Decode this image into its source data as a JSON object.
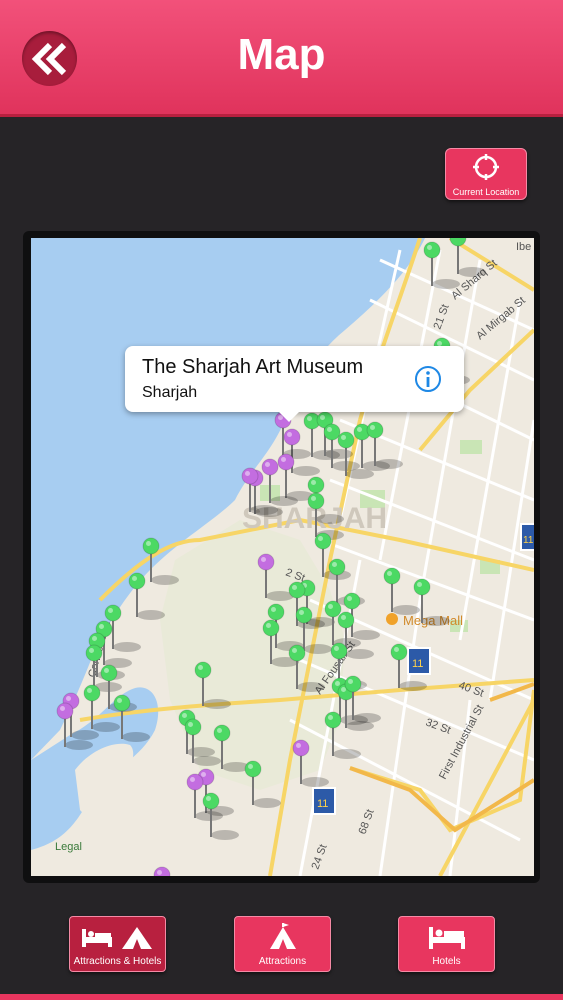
{
  "header": {
    "title": "Map",
    "back_icon": "double-chevron-left-icon"
  },
  "current_location": {
    "label": "Current Location",
    "icon": "crosshair-icon"
  },
  "map": {
    "labels": {
      "city": "SHARJAH",
      "mega_mall": "Mega Mall",
      "al_sharq_st": "Al Sharq St",
      "al_mirgab_st": "Al Mirgab St",
      "st21": "21 St",
      "st2": "2 St",
      "st40": "40 St",
      "st32": "32 St",
      "st68": "68 St",
      "st24": "24 St",
      "first_industrial_st": "First Industrial St",
      "al_fousail": "Al Fousail St",
      "corniche": "Corniche St",
      "legal": "Legal",
      "route11_a": "11",
      "route11_b": "11",
      "route11_c": "11",
      "ibe": "Ibe"
    },
    "callout": {
      "title": "The Sharjah Art Museum",
      "subtitle": "Sharjah",
      "icon": "info-icon"
    },
    "pin_colors": {
      "attraction": "#4cd964",
      "hotel": "#c36de0"
    }
  },
  "tabs": [
    {
      "label": "Attractions & Hotels",
      "icon": "bed-and-tent-icon",
      "active": true
    },
    {
      "label": "Attractions",
      "icon": "tent-icon",
      "active": false
    },
    {
      "label": "Hotels",
      "icon": "bed-icon",
      "active": false
    }
  ]
}
